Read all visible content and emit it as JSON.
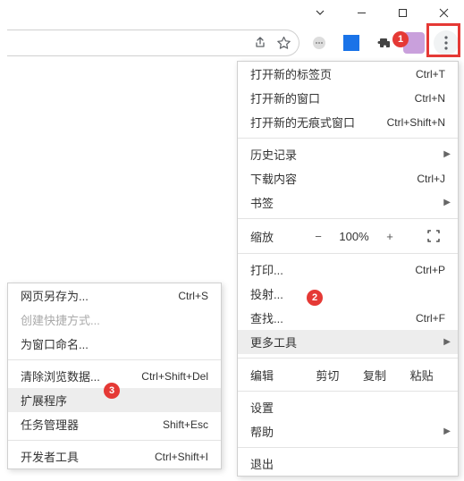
{
  "windowControls": {
    "dropdown": "⌄",
    "minimize": "—",
    "maximize": "☐",
    "close": "✕"
  },
  "toolbar": {
    "share": "↗",
    "star": "☆",
    "chat": "⋯",
    "app": "app",
    "puzzle": "✦",
    "more": "⋮"
  },
  "annotations": {
    "one": "1",
    "two": "2",
    "three": "3"
  },
  "menu": {
    "newTab": {
      "label": "打开新的标签页",
      "shortcut": "Ctrl+T"
    },
    "newWindow": {
      "label": "打开新的窗口",
      "shortcut": "Ctrl+N"
    },
    "newIncognito": {
      "label": "打开新的无痕式窗口",
      "shortcut": "Ctrl+Shift+N"
    },
    "history": {
      "label": "历史记录"
    },
    "downloads": {
      "label": "下载内容",
      "shortcut": "Ctrl+J"
    },
    "bookmarks": {
      "label": "书签"
    },
    "zoom": {
      "label": "缩放",
      "minus": "−",
      "value": "100%",
      "plus": "+",
      "fullscreen": "⛶"
    },
    "print": {
      "label": "打印...",
      "shortcut": "Ctrl+P"
    },
    "cast": {
      "label": "投射..."
    },
    "find": {
      "label": "查找...",
      "shortcut": "Ctrl+F"
    },
    "moreTools": {
      "label": "更多工具"
    },
    "edit": {
      "label": "编辑",
      "cut": "剪切",
      "copy": "复制",
      "paste": "粘贴"
    },
    "settings": {
      "label": "设置"
    },
    "help": {
      "label": "帮助"
    },
    "exit": {
      "label": "退出"
    }
  },
  "submenu": {
    "saveAs": {
      "label": "网页另存为...",
      "shortcut": "Ctrl+S"
    },
    "createShortcut": {
      "label": "创建快捷方式..."
    },
    "nameWindow": {
      "label": "为窗口命名..."
    },
    "clearData": {
      "label": "清除浏览数据...",
      "shortcut": "Ctrl+Shift+Del"
    },
    "extensions": {
      "label": "扩展程序"
    },
    "taskManager": {
      "label": "任务管理器",
      "shortcut": "Shift+Esc"
    },
    "devTools": {
      "label": "开发者工具",
      "shortcut": "Ctrl+Shift+I"
    }
  }
}
